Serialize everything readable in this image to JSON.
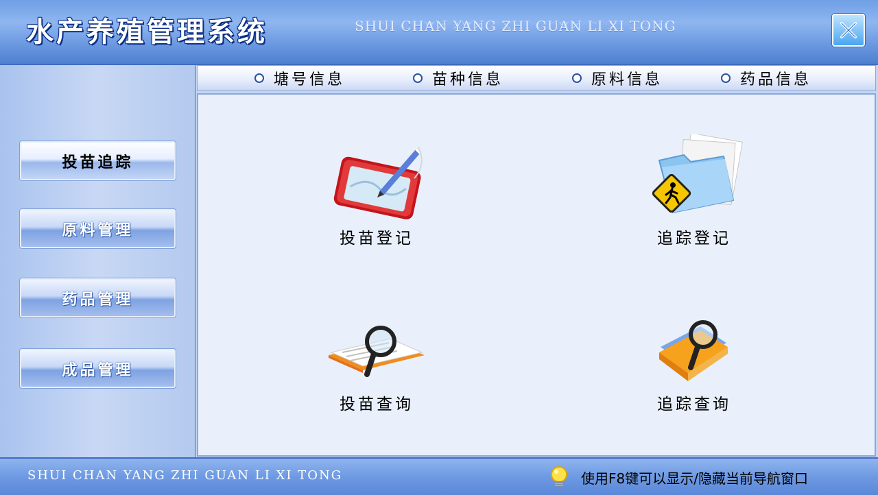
{
  "header": {
    "title": "水产养殖管理系统",
    "subtitle": "SHUI CHAN YANG ZHI GUAN LI XI TONG",
    "close_icon": "close-icon"
  },
  "sidebar": {
    "items": [
      {
        "label": "投苗追踪",
        "active": true
      },
      {
        "label": "原料管理",
        "active": false
      },
      {
        "label": "药品管理",
        "active": false
      },
      {
        "label": "成品管理",
        "active": false
      }
    ]
  },
  "radio_bar": {
    "options": [
      "塘号信息",
      "苗种信息",
      "原料信息",
      "药品信息"
    ]
  },
  "main": {
    "tiles": [
      {
        "label": "投苗登记",
        "icon": "pen-tablet-icon"
      },
      {
        "label": "追踪登记",
        "icon": "folder-pedestrian-icon"
      },
      {
        "label": "投苗查询",
        "icon": "document-magnifier-icon"
      },
      {
        "label": "追踪查询",
        "icon": "folder-magnifier-icon"
      }
    ]
  },
  "footer": {
    "subtitle": "SHUI CHAN YANG ZHI GUAN LI XI TONG",
    "hint": "使用F8键可以显示/隐藏当前导航窗口",
    "hint_icon": "lightbulb-icon"
  },
  "colors": {
    "accent": "#4f7fd0",
    "panel": "#e9f0fb"
  }
}
